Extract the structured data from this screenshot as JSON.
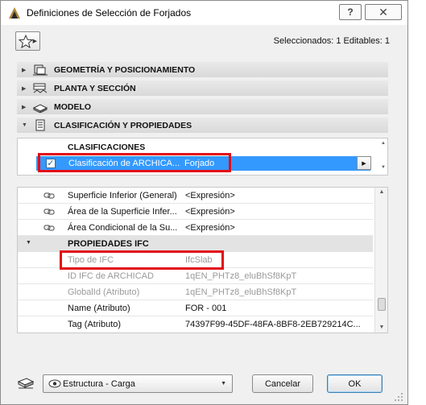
{
  "window": {
    "title": "Definiciones de Selección de Forjados",
    "help_label": "?",
    "close_label": "✕"
  },
  "header": {
    "selection_info": "Seleccionados: 1 Editables: 1"
  },
  "sections": [
    {
      "label": "GEOMETRÍA Y POSICIONAMIENTO",
      "expanded": false,
      "icon": "geometry-icon"
    },
    {
      "label": "PLANTA Y SECCIÓN",
      "expanded": false,
      "icon": "floor-plan-icon"
    },
    {
      "label": "MODELO",
      "expanded": false,
      "icon": "model-icon"
    },
    {
      "label": "CLASIFICACIÓN Y PROPIEDADES",
      "expanded": true,
      "icon": "properties-icon"
    }
  ],
  "classification": {
    "heading": "CLASIFICACIONES",
    "row": {
      "name": "Clasificación de ARCHICA...",
      "value": "Forjado",
      "checked": true
    }
  },
  "properties": {
    "rows": [
      {
        "name": "Superficie Inferior (General)",
        "value": "<Expresión>"
      },
      {
        "name": "Área de la Superficie Infer...",
        "value": "<Expresión>"
      },
      {
        "name": "Área Condicional de la Su...",
        "value": "<Expresión>"
      }
    ],
    "ifc_group": "PROPIEDADES IFC",
    "ifc_rows": [
      {
        "name": "Tipo de IFC",
        "value": "IfcSlab",
        "dim": true
      },
      {
        "name": "ID IFC de ARCHICAD",
        "value": "1qEN_PHTz8_eluBhSf8KpT",
        "dim": true
      },
      {
        "name": "GlobalId (Atributo)",
        "value": "1qEN_PHTz8_eluBhSf8KpT",
        "dim": true
      },
      {
        "name": "Name (Atributo)",
        "value": "FOR - 001",
        "dim": false
      },
      {
        "name": "Tag (Atributo)",
        "value": "74397F99-45DF-48FA-8BF8-2EB729214C...",
        "dim": false
      }
    ]
  },
  "footer": {
    "view_label": "Estructura - Carga",
    "cancel_label": "Cancelar",
    "ok_label": "OK"
  },
  "colors": {
    "selection": "#3399ff",
    "highlight": "#e30b17"
  }
}
